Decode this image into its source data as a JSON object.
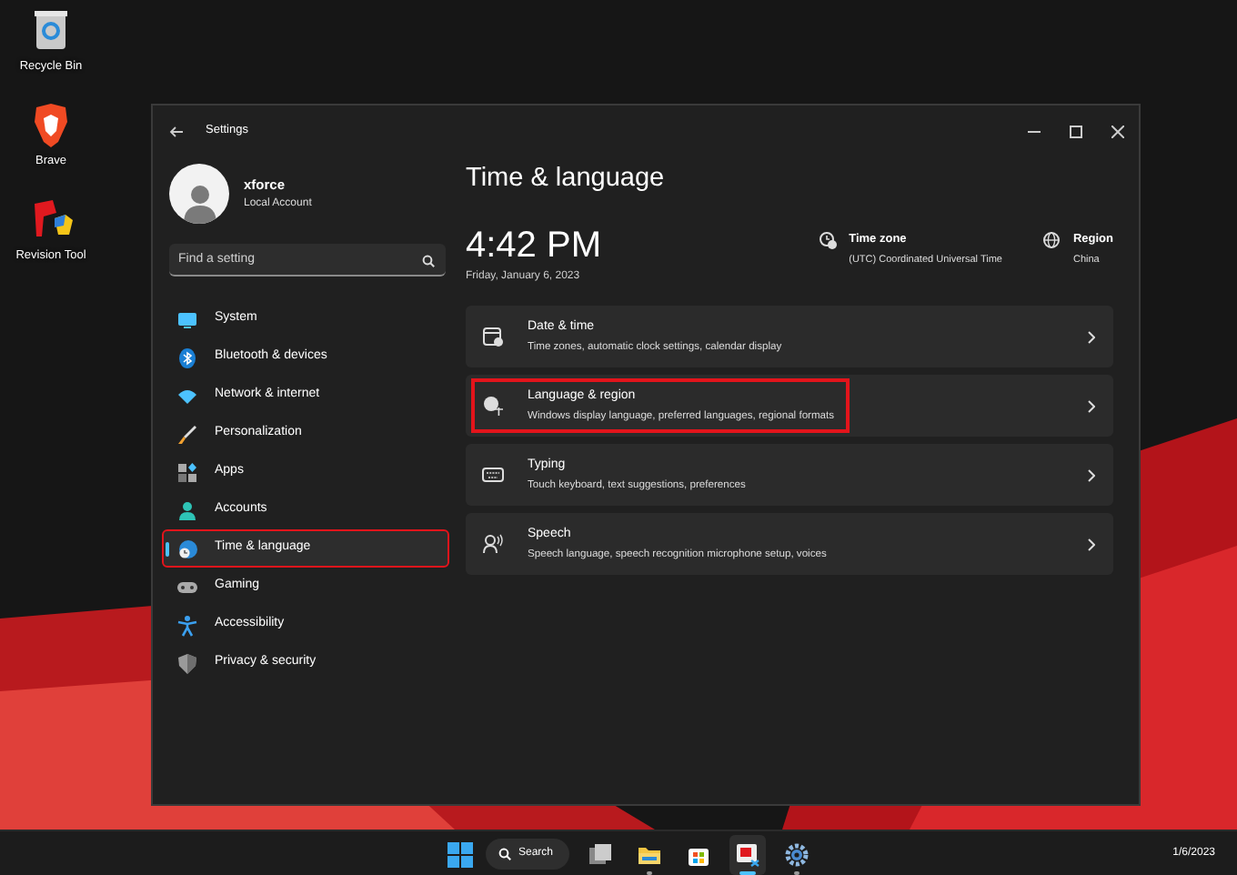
{
  "desktop_icons": [
    {
      "label": "Recycle Bin",
      "kind": "recycle"
    },
    {
      "label": "Brave",
      "kind": "brave"
    },
    {
      "label": "Revision Tool",
      "kind": "revision"
    }
  ],
  "window": {
    "title": "Settings"
  },
  "account": {
    "name": "xforce",
    "type": "Local Account"
  },
  "search": {
    "placeholder": "Find a setting"
  },
  "nav": [
    {
      "label": "System",
      "kind": "system",
      "selected": false,
      "highlighted": false
    },
    {
      "label": "Bluetooth & devices",
      "kind": "bluetooth",
      "selected": false,
      "highlighted": false
    },
    {
      "label": "Network & internet",
      "kind": "network",
      "selected": false,
      "highlighted": false
    },
    {
      "label": "Personalization",
      "kind": "brush",
      "selected": false,
      "highlighted": false
    },
    {
      "label": "Apps",
      "kind": "apps",
      "selected": false,
      "highlighted": false
    },
    {
      "label": "Accounts",
      "kind": "accounts",
      "selected": false,
      "highlighted": false
    },
    {
      "label": "Time & language",
      "kind": "time",
      "selected": true,
      "highlighted": true
    },
    {
      "label": "Gaming",
      "kind": "gaming",
      "selected": false,
      "highlighted": false
    },
    {
      "label": "Accessibility",
      "kind": "accessibility",
      "selected": false,
      "highlighted": false
    },
    {
      "label": "Privacy & security",
      "kind": "shield",
      "selected": false,
      "highlighted": false
    }
  ],
  "page": {
    "title": "Time & language",
    "time": "4:42 PM",
    "date": "Friday, January 6, 2023",
    "info": [
      {
        "kind": "timezone",
        "label": "Time zone",
        "value": "(UTC) Coordinated Universal Time"
      },
      {
        "kind": "region",
        "label": "Region",
        "value": "China"
      }
    ],
    "cards": [
      {
        "kind": "calendar",
        "title": "Date & time",
        "description": "Time zones, automatic clock settings, calendar display",
        "highlighted": false
      },
      {
        "kind": "language",
        "title": "Language & region",
        "description": "Windows display language, preferred languages, regional formats",
        "highlighted": true
      },
      {
        "kind": "keyboard",
        "title": "Typing",
        "description": "Touch keyboard, text suggestions, preferences",
        "highlighted": false
      },
      {
        "kind": "speech",
        "title": "Speech",
        "description": "Speech language, speech recognition microphone setup, voices",
        "highlighted": false
      }
    ]
  },
  "taskbar": {
    "search_label": "Search",
    "apps": [
      {
        "kind": "taskview",
        "running": false,
        "active": false
      },
      {
        "kind": "folder",
        "running": true,
        "active": false
      },
      {
        "kind": "store",
        "running": false,
        "active": false
      },
      {
        "kind": "snip",
        "running": true,
        "active": true
      },
      {
        "kind": "gear",
        "running": true,
        "active": false
      }
    ],
    "date": "1/6/2023"
  }
}
